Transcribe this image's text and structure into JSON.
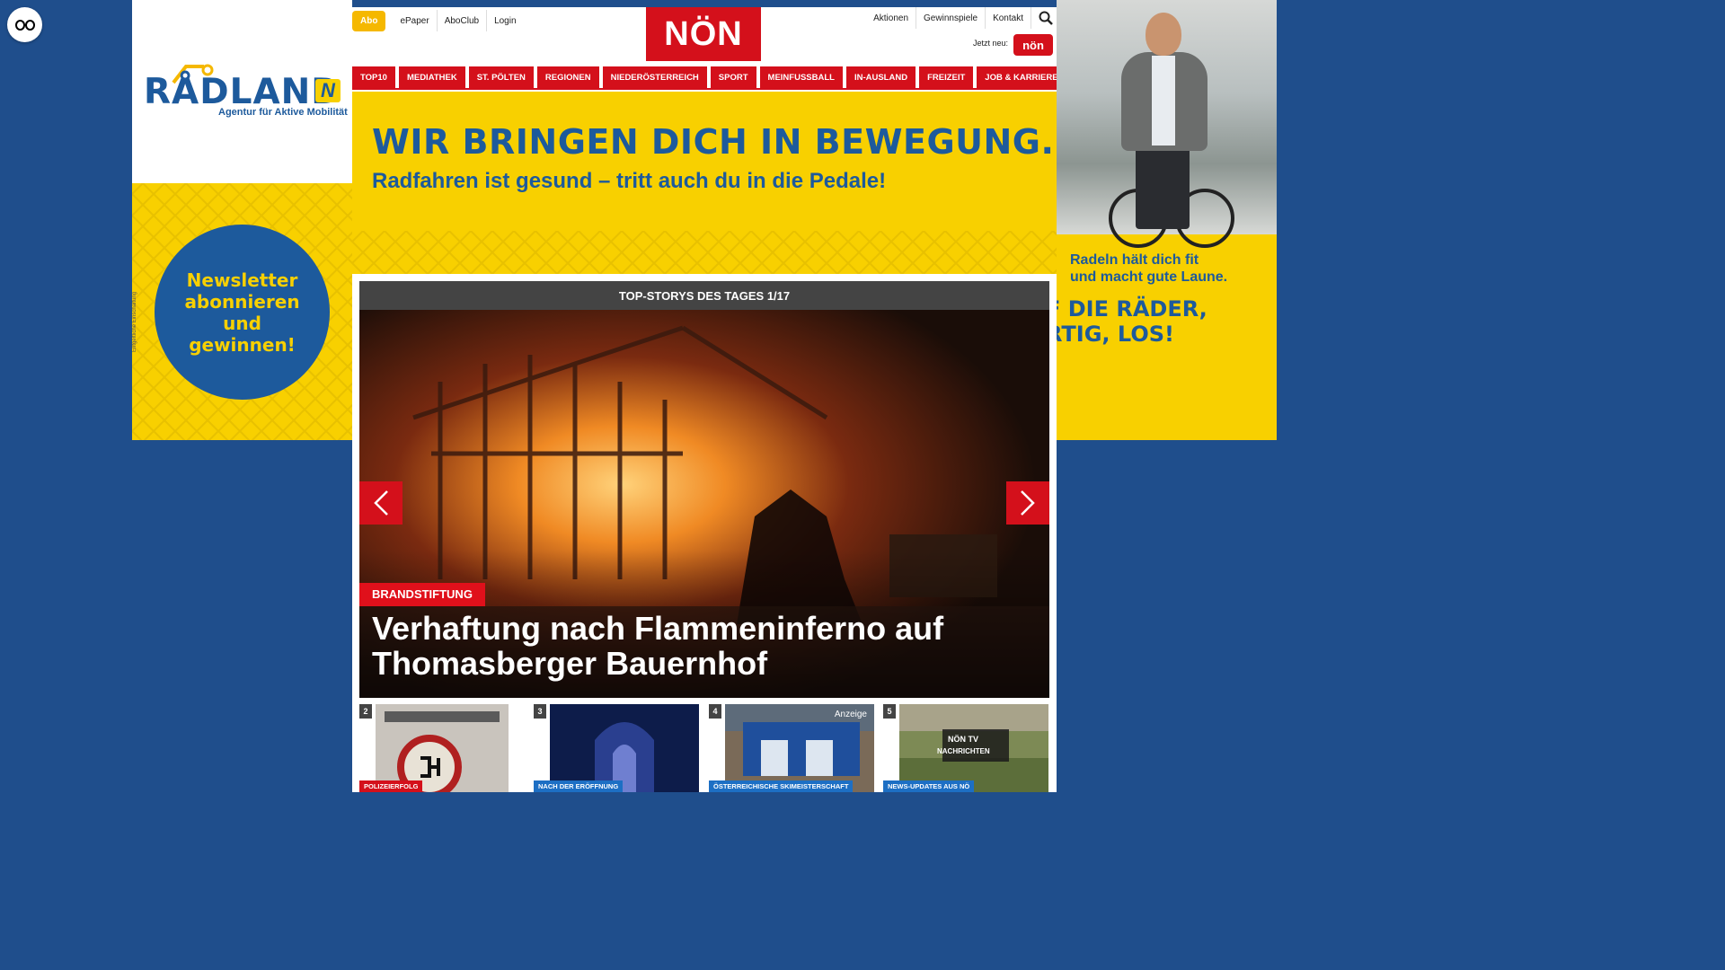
{
  "accessibility": {
    "icon": "eye-glasses-icon"
  },
  "left_ad": {
    "brand": "RÅDLAND",
    "brand_mark": "N",
    "subtitle": "Agentur für Aktive Mobilität",
    "circle_text": "Newsletter abonnieren und gewinnen!",
    "disclaimer": "Entgeltliche Einschaltung",
    "colors": {
      "yellow": "#f8d000",
      "blue": "#1d5a9c"
    }
  },
  "right_ad": {
    "tagline_1": "Radeln hält dich fit",
    "tagline_2": "und macht gute Laune.",
    "headline_1": "F DIE RÄDER,",
    "headline_2": "RTIG, LOS!"
  },
  "header": {
    "abo_label": "Abo",
    "left_links": [
      "ePaper",
      "AboClub",
      "Login"
    ],
    "logo_text": "NÖN",
    "right_links": [
      "Aktionen",
      "Gewinnspiele",
      "Kontakt"
    ],
    "jetzt_neu": "Jetzt neu:",
    "kleine_badge": "nön",
    "colors": {
      "brand_red": "#d4101b",
      "abo_orange": "#f5b800"
    }
  },
  "nav": {
    "items": [
      "TOP10",
      "MEDIATHEK",
      "ST. PÖLTEN",
      "REGIONEN",
      "NIEDERÖSTERREICH",
      "SPORT",
      "MEINFUSSBALL",
      "IN-AUSLAND",
      "FREIZEIT",
      "JOB & KARRIERE"
    ]
  },
  "billboard": {
    "headline": "WIR BRINGEN DICH IN BEWEGUNG.",
    "sub": "Radfahren ist gesund – tritt auch du in die Pedale!"
  },
  "slider": {
    "header": "TOP-STORYS DES TAGES 1/17",
    "kicker": "BRANDSTIFTUNG",
    "title": "Verhaftung nach Flammeninferno auf Thomasberger Bauernhof"
  },
  "teasers": [
    {
      "num": "2",
      "label": "POLIZEIERFOLG"
    },
    {
      "num": "3",
      "label": "NACH DER ERÖFFNUNG"
    },
    {
      "num": "4",
      "label": "ÖSTERREICHISCHE SKIMEISTERSCHAFT",
      "anzeige": "Anzeige"
    },
    {
      "num": "5",
      "label": "NEWS-UPDATES AUS NÖ",
      "tv_1": "NÖN TV",
      "tv_2": "NACHRICHTEN"
    }
  ]
}
